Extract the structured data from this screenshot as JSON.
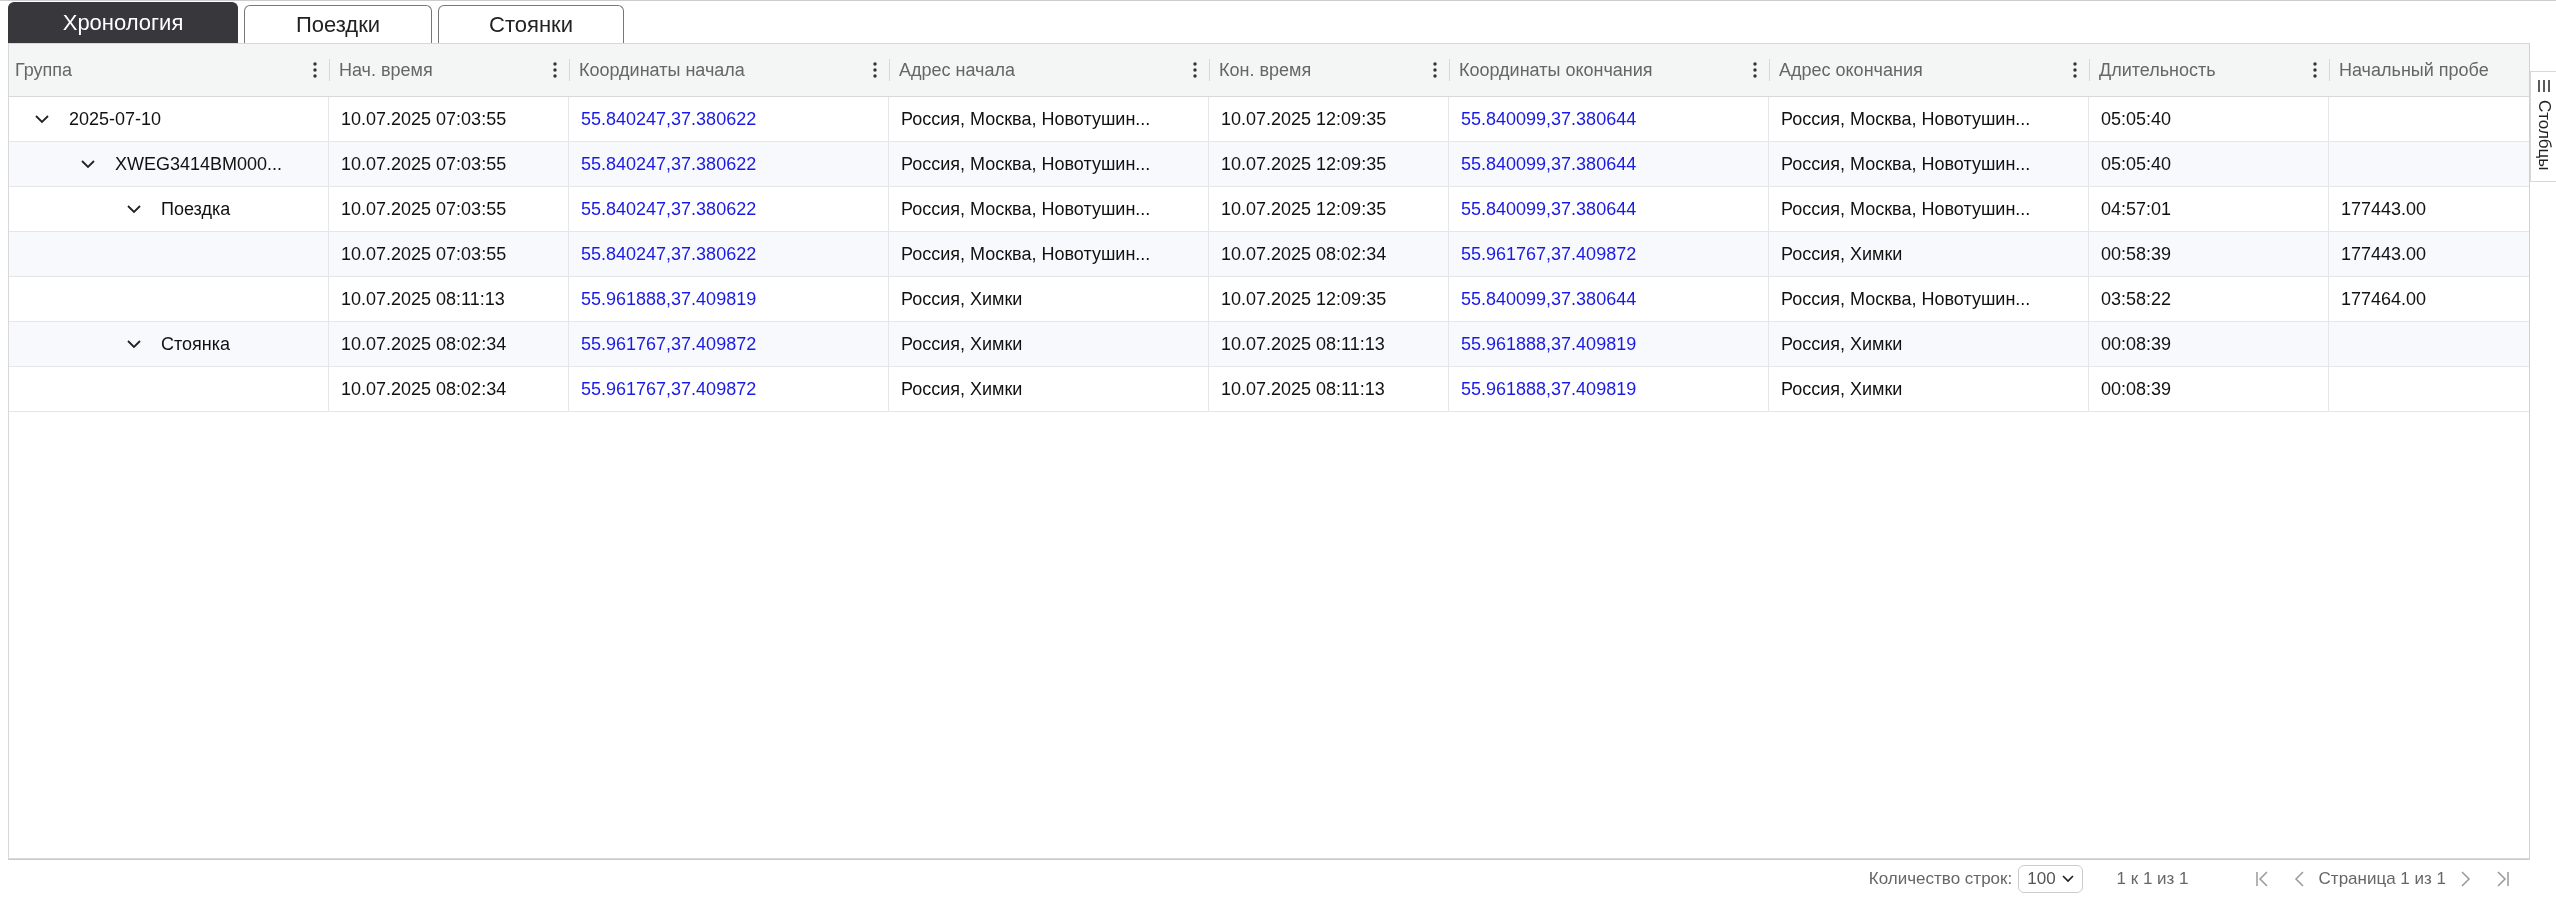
{
  "tabs": [
    {
      "label": "Хронология",
      "selected": true
    },
    {
      "label": "Поездки",
      "selected": false
    },
    {
      "label": "Стоянки",
      "selected": false
    }
  ],
  "table": {
    "columns": [
      {
        "label": "Группа",
        "kind": "group",
        "menu": true
      },
      {
        "label": "Нач. время",
        "kind": "text",
        "menu": true
      },
      {
        "label": "Координаты начала",
        "kind": "link",
        "menu": true
      },
      {
        "label": "Адрес начала",
        "kind": "text",
        "menu": true
      },
      {
        "label": "Кон. время",
        "kind": "text",
        "menu": true
      },
      {
        "label": "Координаты окончания",
        "kind": "link",
        "menu": true
      },
      {
        "label": "Адрес окончания",
        "kind": "text",
        "menu": true
      },
      {
        "label": "Длительность",
        "kind": "text",
        "menu": true
      },
      {
        "label": "Начальный пробе",
        "kind": "text",
        "menu": false
      }
    ],
    "rows": [
      {
        "expanded": true,
        "cells": [
          "2025-07-10",
          "10.07.2025 07:03:55",
          "55.840247,37.380622",
          "Россия, Москва, Новотушин...",
          "10.07.2025 12:09:35",
          "55.840099,37.380644",
          "Россия, Москва, Новотушин...",
          "05:05:40"
        ],
        "children": [
          {
            "expanded": true,
            "cells": [
              "XWEG3414BM000...",
              "10.07.2025 07:03:55",
              "55.840247,37.380622",
              "Россия, Москва, Новотушин...",
              "10.07.2025 12:09:35",
              "55.840099,37.380644",
              "Россия, Москва, Новотушин...",
              "05:05:40"
            ],
            "children": [
              {
                "expanded": true,
                "cells": [
                  "Поездка",
                  "10.07.2025 07:03:55",
                  "55.840247,37.380622",
                  "Россия, Москва, Новотушин...",
                  "10.07.2025 12:09:35",
                  "55.840099,37.380644",
                  "Россия, Москва, Новотушин...",
                  "04:57:01",
                  "177443.00"
                ],
                "children": [
                  {
                    "cells": [
                      "",
                      "10.07.2025 07:03:55",
                      "55.840247,37.380622",
                      "Россия, Москва, Новотушин...",
                      "10.07.2025 08:02:34",
                      "55.961767,37.409872",
                      "Россия, Химки",
                      "00:58:39",
                      "177443.00"
                    ]
                  },
                  {
                    "cells": [
                      "",
                      "10.07.2025 08:11:13",
                      "55.961888,37.409819",
                      "Россия, Химки",
                      "10.07.2025 12:09:35",
                      "55.840099,37.380644",
                      "Россия, Москва, Новотушин...",
                      "03:58:22",
                      "177464.00"
                    ]
                  }
                ]
              },
              {
                "expanded": true,
                "cells": [
                  "Стоянка",
                  "10.07.2025 08:02:34",
                  "55.961767,37.409872",
                  "Россия, Химки",
                  "10.07.2025 08:11:13",
                  "55.961888,37.409819",
                  "Россия, Химки",
                  "00:08:39"
                ],
                "children": [
                  {
                    "cells": [
                      "",
                      "10.07.2025 08:02:34",
                      "55.961767,37.409872",
                      "Россия, Химки",
                      "10.07.2025 08:11:13",
                      "55.961888,37.409819",
                      "Россия, Химки",
                      "00:08:39"
                    ]
                  }
                ]
              }
            ]
          }
        ]
      }
    ]
  },
  "side_panel": {
    "label": "Столбцы"
  },
  "footer": {
    "rows_label": "Количество строк:",
    "page_size": "100",
    "range": "1 к 1 из 1",
    "page": "Страница 1 из 1"
  }
}
